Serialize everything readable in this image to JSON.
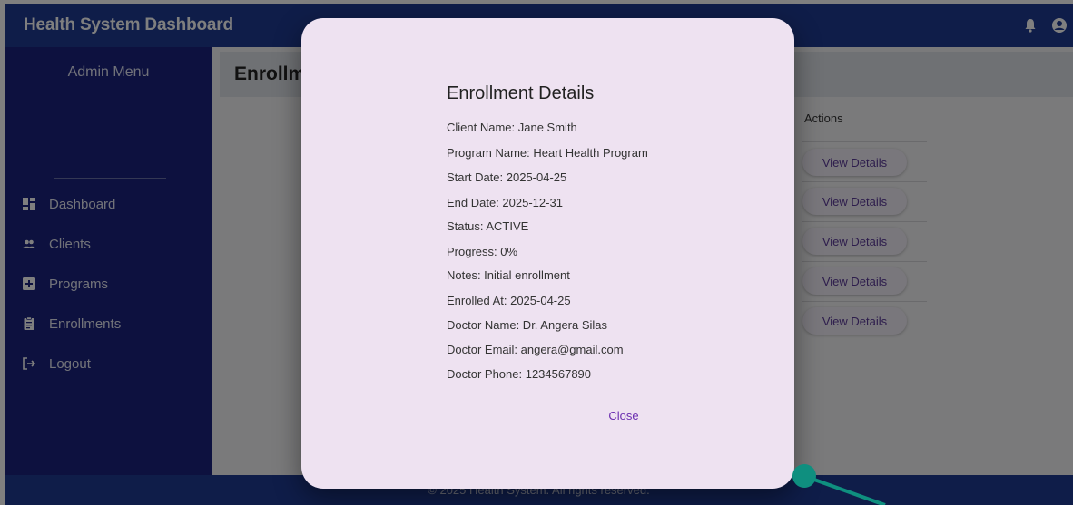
{
  "app": {
    "title": "Health System Dashboard"
  },
  "sidebar": {
    "menu_title": "Admin Menu",
    "items": [
      {
        "label": "Dashboard",
        "icon": "dashboard-icon"
      },
      {
        "label": "Clients",
        "icon": "people-icon"
      },
      {
        "label": "Programs",
        "icon": "medical-plus-icon"
      },
      {
        "label": "Enrollments",
        "icon": "clipboard-icon"
      },
      {
        "label": "Logout",
        "icon": "logout-icon"
      }
    ]
  },
  "main": {
    "page_title": "Enrollm",
    "actions_header": "Actions",
    "rows": [
      {
        "action": "View Details"
      },
      {
        "action": "View Details"
      },
      {
        "action": "View Details"
      },
      {
        "action": "View Details"
      },
      {
        "action": "View Details"
      }
    ]
  },
  "footer": {
    "text": "© 2025 Health System. All rights reserved."
  },
  "modal": {
    "title": "Enrollment Details",
    "fields": [
      "Client Name: Jane Smith",
      "Program Name: Heart Health Program",
      "Start Date: 2025-04-25",
      "End Date: 2025-12-31",
      "Status: ACTIVE",
      "Progress: 0%",
      "Notes: Initial enrollment",
      "Enrolled At: 2025-04-25",
      "Doctor Name: Dr. Angera Silas",
      "Doctor Email: angera@gmail.com",
      "Doctor Phone: 1234567890"
    ],
    "close_label": "Close"
  },
  "colors": {
    "topbar": "#1f3a93",
    "sidebar": "#1a237e",
    "modal_bg": "#eee2f1",
    "accent": "#6a2db0",
    "handle": "#0f8f7f"
  }
}
